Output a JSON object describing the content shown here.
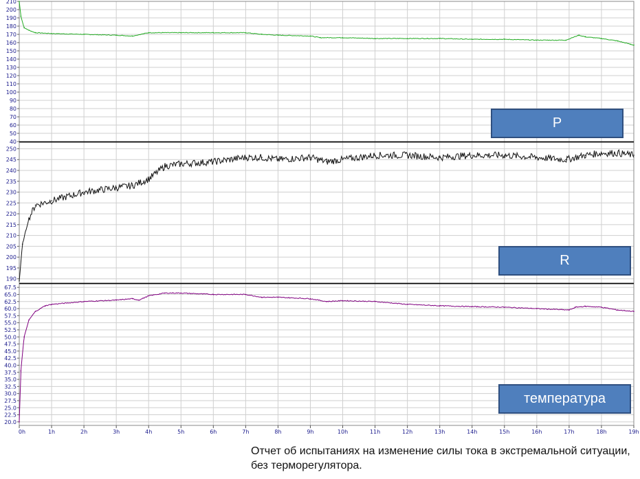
{
  "chart_data": [
    {
      "type": "line",
      "label": "P",
      "color": "#22aa22",
      "ylim": [
        40,
        210
      ],
      "yticks": [
        "210",
        "200",
        "190",
        "180",
        "170",
        "160",
        "150",
        "140",
        "130",
        "120",
        "110",
        "100",
        "90",
        "80",
        "70",
        "60",
        "50",
        "40"
      ],
      "x": [
        0,
        0.05,
        0.15,
        0.3,
        0.5,
        1,
        2,
        3,
        3.5,
        4,
        5,
        6,
        7,
        7.5,
        8,
        9,
        9.3,
        10,
        11,
        12,
        13,
        14,
        15,
        16,
        16.9,
        17.3,
        17.5,
        18,
        18.5,
        18.9,
        19
      ],
      "values": [
        210,
        192,
        178,
        175,
        172,
        171,
        170,
        169,
        168,
        172,
        172,
        172,
        172,
        170,
        169,
        168,
        166,
        166,
        165,
        165,
        165,
        164,
        164,
        163,
        163,
        169,
        167,
        165,
        162,
        158,
        157
      ]
    },
    {
      "type": "line",
      "label": "R",
      "color": "#111111",
      "ylim": [
        188,
        253
      ],
      "yticks": [
        "250",
        "245",
        "240",
        "235",
        "230",
        "225",
        "220",
        "215",
        "210",
        "205",
        "200",
        "195",
        "190"
      ],
      "x": [
        0,
        0.1,
        0.3,
        0.5,
        1,
        2,
        3,
        3.5,
        4,
        4.5,
        5,
        6,
        7,
        7.5,
        8,
        9,
        9.5,
        10,
        11,
        12,
        13,
        14,
        15,
        16,
        16.9,
        17.5,
        18,
        18.5,
        19
      ],
      "values": [
        189,
        206,
        218,
        224,
        226,
        230,
        232,
        233,
        236,
        242,
        243,
        244,
        246,
        246,
        245,
        246,
        244,
        245,
        247,
        247,
        246,
        247,
        247,
        246,
        245,
        247,
        248,
        248,
        247
      ]
    },
    {
      "type": "line",
      "label": "температура",
      "color": "#800080",
      "ylim": [
        18.75,
        68.75
      ],
      "yticks": [
        "67.5",
        "65.0",
        "62.5",
        "60.0",
        "57.5",
        "55.0",
        "52.5",
        "50.0",
        "47.5",
        "45.0",
        "42.5",
        "40.0",
        "37.5",
        "35.0",
        "32.5",
        "30.0",
        "27.5",
        "25.0",
        "22.5",
        "20.0"
      ],
      "x": [
        0,
        0.05,
        0.15,
        0.3,
        0.5,
        0.8,
        1,
        2,
        3,
        3.5,
        3.7,
        4,
        4.5,
        5,
        6,
        7,
        7.5,
        8,
        9,
        9.5,
        10,
        11,
        12,
        13,
        14,
        15,
        16,
        17,
        17.2,
        17.5,
        18,
        18.5,
        19
      ],
      "values": [
        20,
        38,
        50,
        56,
        59,
        61,
        61.5,
        62.5,
        63,
        63.5,
        63,
        64.5,
        65.5,
        65.5,
        65,
        65,
        64,
        64,
        63.5,
        62.5,
        62.8,
        62.5,
        61.5,
        61,
        60.7,
        60.5,
        60,
        59.5,
        60.5,
        60.8,
        60.5,
        59.5,
        59
      ]
    }
  ],
  "x_axis": {
    "xlim": [
      0,
      19
    ],
    "ticks": [
      "0h",
      "1h",
      "2h",
      "3h",
      "4h",
      "5h",
      "6h",
      "7h",
      "8h",
      "9h",
      "10h",
      "11h",
      "12h",
      "13h",
      "14h",
      "15h",
      "16h",
      "17h",
      "18h",
      "19h"
    ]
  },
  "caption": "Отчет об испытаниях на изменение силы тока в экстремальной ситуации, без терморегулятора."
}
